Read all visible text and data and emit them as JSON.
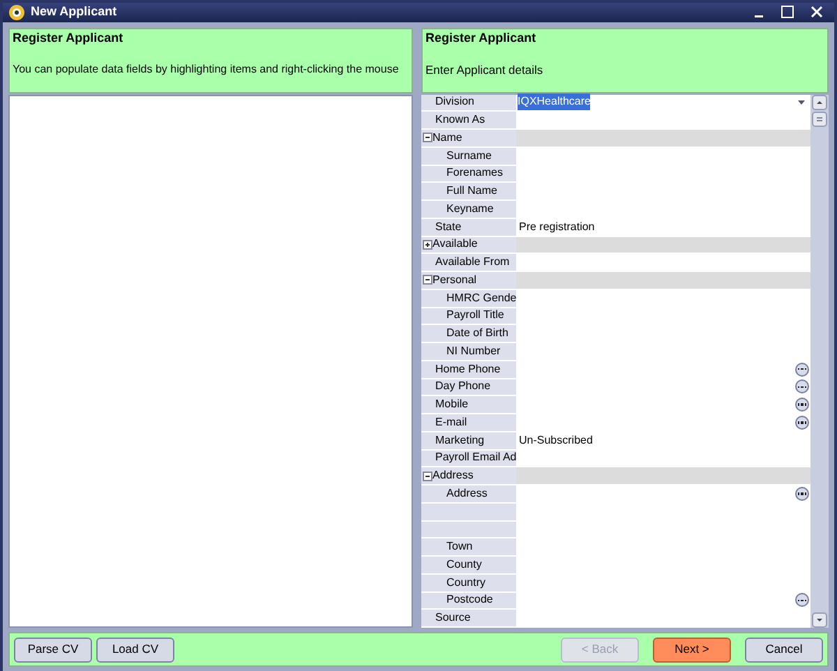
{
  "window": {
    "title": "New Applicant"
  },
  "left_header": {
    "title": "Register Applicant",
    "text": "You can populate data fields by highlighting items and right-clicking the mouse"
  },
  "right_header": {
    "title": "Register Applicant",
    "text": "Enter Applicant details"
  },
  "rows": [
    {
      "kind": "dropdown",
      "label": "Division",
      "value": "IQXHealthcare",
      "selected": true
    },
    {
      "kind": "field",
      "label": "Known As"
    },
    {
      "kind": "group",
      "label": "Name",
      "expanded": true,
      "children": [
        {
          "kind": "field",
          "label": "Surname"
        },
        {
          "kind": "field",
          "label": "Forenames"
        },
        {
          "kind": "field",
          "label": "Full Name"
        },
        {
          "kind": "field",
          "label": "Keyname"
        }
      ]
    },
    {
      "kind": "field",
      "label": "State",
      "value": "Pre registration"
    },
    {
      "kind": "group",
      "label": "Available",
      "expanded": false
    },
    {
      "kind": "field",
      "label": "Available From"
    },
    {
      "kind": "group",
      "label": "Personal",
      "expanded": true,
      "children": [
        {
          "kind": "field",
          "label": "HMRC Gende"
        },
        {
          "kind": "field",
          "label": "Payroll Title"
        },
        {
          "kind": "field",
          "label": "Date of Birth"
        },
        {
          "kind": "field",
          "label": "NI Number"
        }
      ]
    },
    {
      "kind": "field",
      "label": "Home Phone",
      "ellipsis": true
    },
    {
      "kind": "field",
      "label": "Day Phone",
      "ellipsis": true
    },
    {
      "kind": "field",
      "label": "Mobile",
      "ellipsis": true
    },
    {
      "kind": "field",
      "label": "E-mail",
      "ellipsis": true
    },
    {
      "kind": "field",
      "label": "Marketing",
      "value": "Un-Subscribed"
    },
    {
      "kind": "field",
      "label": "Payroll Email Ad"
    },
    {
      "kind": "group",
      "label": "Address",
      "expanded": true,
      "children": [
        {
          "kind": "field",
          "label": "Address",
          "ellipsis": true
        },
        {
          "kind": "blank"
        },
        {
          "kind": "blank"
        },
        {
          "kind": "field",
          "label": "Town"
        },
        {
          "kind": "field",
          "label": "County"
        },
        {
          "kind": "field",
          "label": "Country"
        },
        {
          "kind": "field",
          "label": "Postcode",
          "ellipsis": true
        }
      ]
    },
    {
      "kind": "field",
      "label": "Source"
    }
  ],
  "buttons_left": [
    {
      "label": "Parse CV",
      "disabled": false
    },
    {
      "label": "Load CV",
      "disabled": false
    }
  ],
  "buttons_right": [
    {
      "label": "< Back",
      "disabled": true,
      "primary": false
    },
    {
      "label": "Next >",
      "disabled": false,
      "primary": true
    },
    {
      "label": "Cancel",
      "disabled": false,
      "primary": false
    }
  ]
}
